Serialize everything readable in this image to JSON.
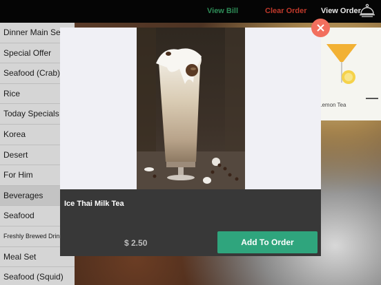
{
  "topbar": {
    "view_bill": "View Bill",
    "clear_order": "Clear Order",
    "view_order": "View Order",
    "icons": {
      "order": "cloche-icon"
    }
  },
  "sidebar": {
    "items": [
      {
        "label": "Dinner Main Set"
      },
      {
        "label": "Special Offer"
      },
      {
        "label": "Seafood (Crab)"
      },
      {
        "label": "Rice"
      },
      {
        "label": "Today Specials"
      },
      {
        "label": "Korea"
      },
      {
        "label": "Desert"
      },
      {
        "label": "For Him"
      },
      {
        "label": "Beverages"
      },
      {
        "label": "Seafood"
      },
      {
        "label": "Freshly Brewed Drinks"
      },
      {
        "label": "Meal Set"
      },
      {
        "label": "Seafood (Squid)"
      }
    ],
    "active_index": 8
  },
  "background": {
    "card_label": "Lemon Tea"
  },
  "modal": {
    "item_name": "Ice Thai Milk Tea",
    "price": "$ 2.50",
    "add_button": "Add To Order",
    "icons": {
      "close": "close-icon"
    }
  },
  "colors": {
    "view_bill": "#2e8b57",
    "clear_order": "#c0392b",
    "add_button": "#2fa57d",
    "close_button": "#f26f5e"
  }
}
